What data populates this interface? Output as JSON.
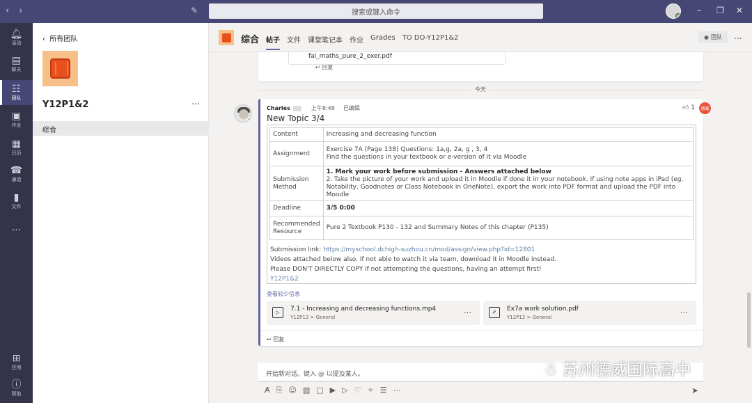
{
  "titlebar": {
    "search_placeholder": "搜索或键入命令",
    "back_icon": "chevron-left-icon",
    "forward_icon": "chevron-right-icon",
    "compose_icon": "compose-icon"
  },
  "rail": {
    "items": [
      {
        "label": "活动",
        "icon": "bell-icon"
      },
      {
        "label": "聊天",
        "icon": "chat-icon"
      },
      {
        "label": "团队",
        "icon": "teams-icon"
      },
      {
        "label": "作业",
        "icon": "assignment-icon"
      },
      {
        "label": "日历",
        "icon": "calendar-icon"
      },
      {
        "label": "通话",
        "icon": "phone-icon"
      },
      {
        "label": "文件",
        "icon": "file-icon"
      },
      {
        "label": "...",
        "icon": "more-icon"
      },
      {
        "label": "应用",
        "icon": "apps-icon"
      },
      {
        "label": "帮助",
        "icon": "help-icon"
      }
    ]
  },
  "panel": {
    "back_label": "所有团队",
    "team_name": "Y12P1&2",
    "more": "...",
    "channel": "综合"
  },
  "header": {
    "channel_title": "综合",
    "tabs": [
      "帖子",
      "文件",
      "课堂笔记本",
      "作业",
      "Grades",
      "TO DO-Y12P1&2"
    ],
    "team_button": "团队",
    "more": "..."
  },
  "feed": {
    "prev_file_name": "fal_maths_pure_2_exer.pdf",
    "prev_reply": "回复",
    "date_divider": "今天",
    "post": {
      "author": "Charles",
      "time": "上午8:48",
      "edited": "已编辑",
      "like_count": "1",
      "reaction_badge": "德威",
      "title": "New Topic 3/4",
      "table": [
        {
          "key": "Content",
          "value": [
            "Increasing and decreasing function"
          ]
        },
        {
          "key": "Assignment",
          "value": [
            "Exercise 7A (Page 138) Questions: 1a,g, 2a, g , 3, 4",
            "Find the questions in your textbook or e-version of it via Moodle"
          ]
        },
        {
          "key": "Submission Method",
          "value": [
            "1. Mark your work before submission - Answers attached below",
            "2. Take the picture of your work and upload it in Moodle if done it in your notebook. If using note apps in iPad (eg. Notability, Goodnotes or Class Notebook in OneNote), export the work into PDF format and upload the PDF into Moodle"
          ]
        },
        {
          "key": "Deadline",
          "value": [
            "3/5 0:00"
          ]
        },
        {
          "key": "Recommended Resource",
          "value": [
            "Pure 2 Textbook P130 - 132 and Summary Notes of this chapter (P135)"
          ]
        }
      ],
      "submission_label": "Submission link: ",
      "submission_url": "https://myschool.dchigh-suzhou.cn/mod/assign/view.php?id=12801",
      "line_videos": "Videos attached below also. If not able to watch it via team, download it in Moodle instead.",
      "line_copy": "Please DON'T DIRECTLY COPY if not attempting the questions, having an attempt first!",
      "tag": "Y12P1&2",
      "see_less": "查看较少信息",
      "attachments": [
        {
          "name": "7.1 - Increasing and decreasing functions.mp4",
          "path": "Y12P12 > General",
          "icon": "video-file-icon"
        },
        {
          "name": "Ex7a work solution.pdf",
          "path": "Y12P12 > General",
          "icon": "pdf-file-icon"
        }
      ],
      "reply": "回复"
    }
  },
  "compose": {
    "placeholder": "开始新对话。键入 @ 以提及某人。"
  },
  "watermark": "苏州德威国际高中",
  "colors": {
    "titlebar": "#464775",
    "rail": "#33344a",
    "accent": "#6264a7",
    "team_orange": "#e8501e"
  }
}
